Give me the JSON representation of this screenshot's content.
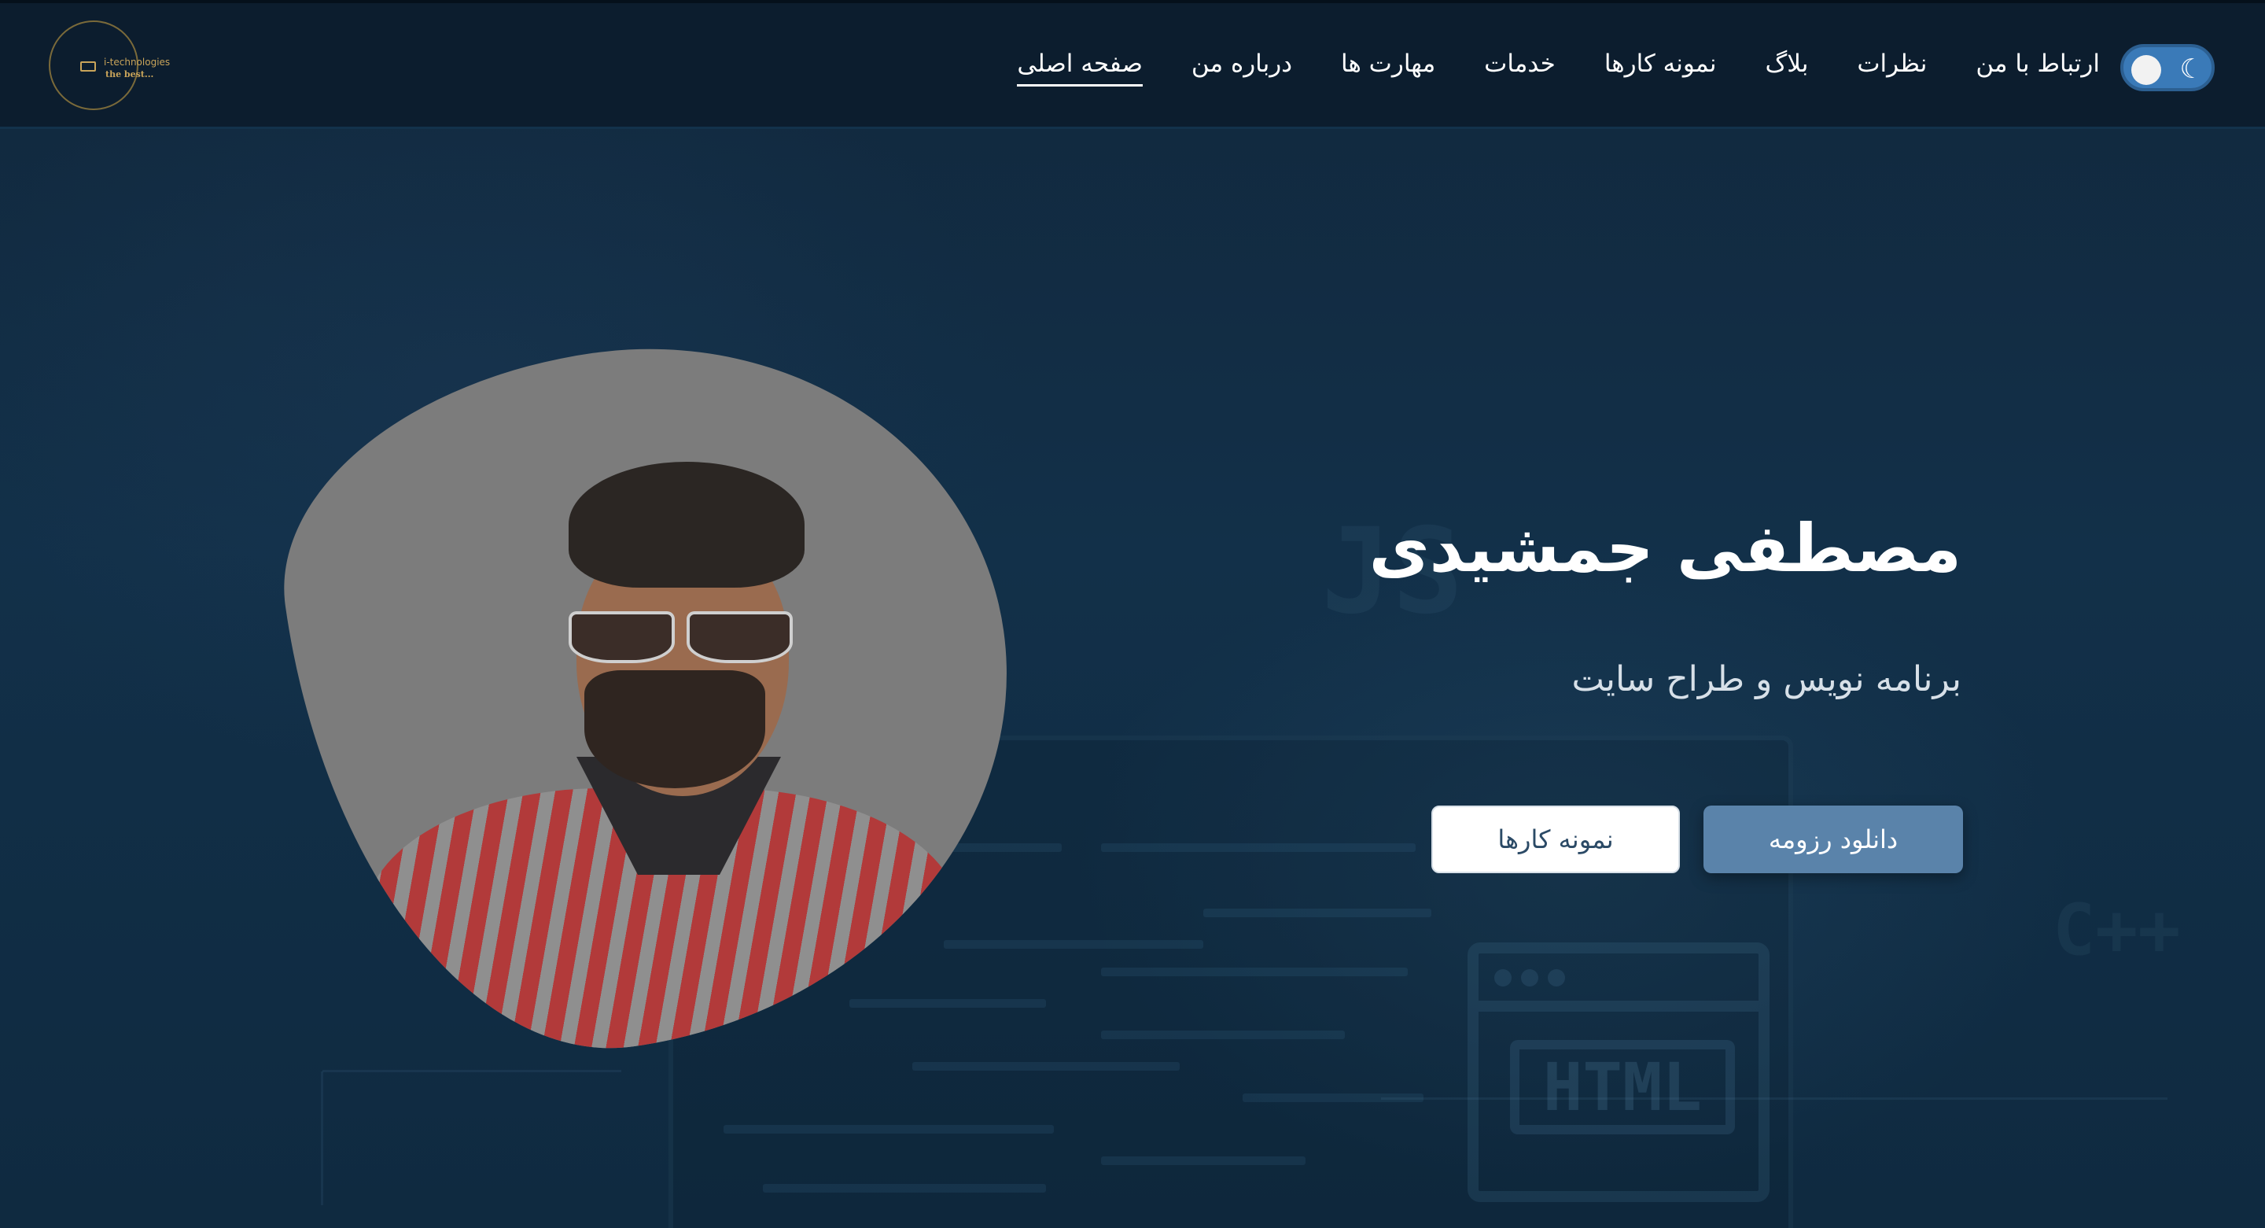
{
  "logo": {
    "name": "i-technologies",
    "tagline": "the best..."
  },
  "nav": {
    "items": [
      {
        "label": "صفحه اصلی",
        "active": true
      },
      {
        "label": "درباره من",
        "active": false
      },
      {
        "label": "مهارت ها",
        "active": false
      },
      {
        "label": "خدمات",
        "active": false
      },
      {
        "label": "نمونه کارها",
        "active": false
      },
      {
        "label": "بلاگ",
        "active": false
      },
      {
        "label": "نظرات",
        "active": false
      },
      {
        "label": "ارتباط با من",
        "active": false
      }
    ],
    "theme_toggle": {
      "icon": "moon-icon",
      "state": "dark"
    }
  },
  "hero": {
    "name": "مصطفی جمشیدی",
    "role": "برنامه نویس و طراح سایت",
    "buttons": {
      "resume": "دانلود رزومه",
      "works": "نمونه کارها"
    },
    "photo": "portrait-photo"
  },
  "background": {
    "code_words": [
      "JS",
      "HTML",
      "C++"
    ]
  },
  "colors": {
    "background": "#0f2438",
    "navbar": "#0c1d2e",
    "accent": "#5a83aa",
    "toggle": "#3a7ab8"
  }
}
